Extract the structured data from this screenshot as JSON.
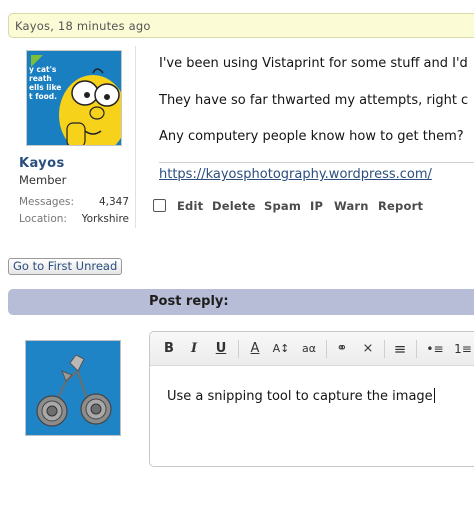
{
  "post": {
    "author_line": "Kayos, 18 minutes ago",
    "username": "Kayos",
    "user_title": "Member",
    "stats": [
      {
        "label": "Messages:",
        "value": "4,347"
      },
      {
        "label": "Location:",
        "value": "Yorkshire"
      }
    ],
    "avatar_text": [
      "y cat's",
      "reath",
      "ells like",
      "t food."
    ],
    "body_lines": [
      "I've been using Vistaprint for some stuff and I'd",
      "They have so far thwarted my attempts, right c",
      "Any computery people know how to get them?"
    ],
    "signature_link": "https://kayosphotography.wordpress.com/",
    "actions": [
      "Edit",
      "Delete",
      "Spam",
      "IP",
      "Warn",
      "Report"
    ]
  },
  "go_first_unread": "Go to First Unread",
  "reply": {
    "heading": "Post reply:",
    "editor_text": "Use a snipping tool to capture the image",
    "toolbar": [
      {
        "name": "bold-button",
        "glyph": "B"
      },
      {
        "name": "italic-button",
        "glyph": "I"
      },
      {
        "name": "underline-button",
        "glyph": "U"
      },
      {
        "name": "font-color-button",
        "glyph": "A"
      },
      {
        "name": "font-size-button",
        "glyph": "A↕"
      },
      {
        "name": "font-family-button",
        "glyph": "aα"
      },
      {
        "name": "link-button",
        "glyph": "⚭"
      },
      {
        "name": "unlink-button",
        "glyph": "⨯"
      },
      {
        "name": "align-button",
        "glyph": "≡"
      },
      {
        "name": "bullet-list-button",
        "glyph": "•≡"
      },
      {
        "name": "number-list-button",
        "glyph": "1≡"
      }
    ]
  },
  "colors": {
    "link": "#2b4e7e",
    "header_bar": "#b7bdd6",
    "topbar": "#fbfbd6",
    "avatar_accent": "#7dbf3a"
  }
}
